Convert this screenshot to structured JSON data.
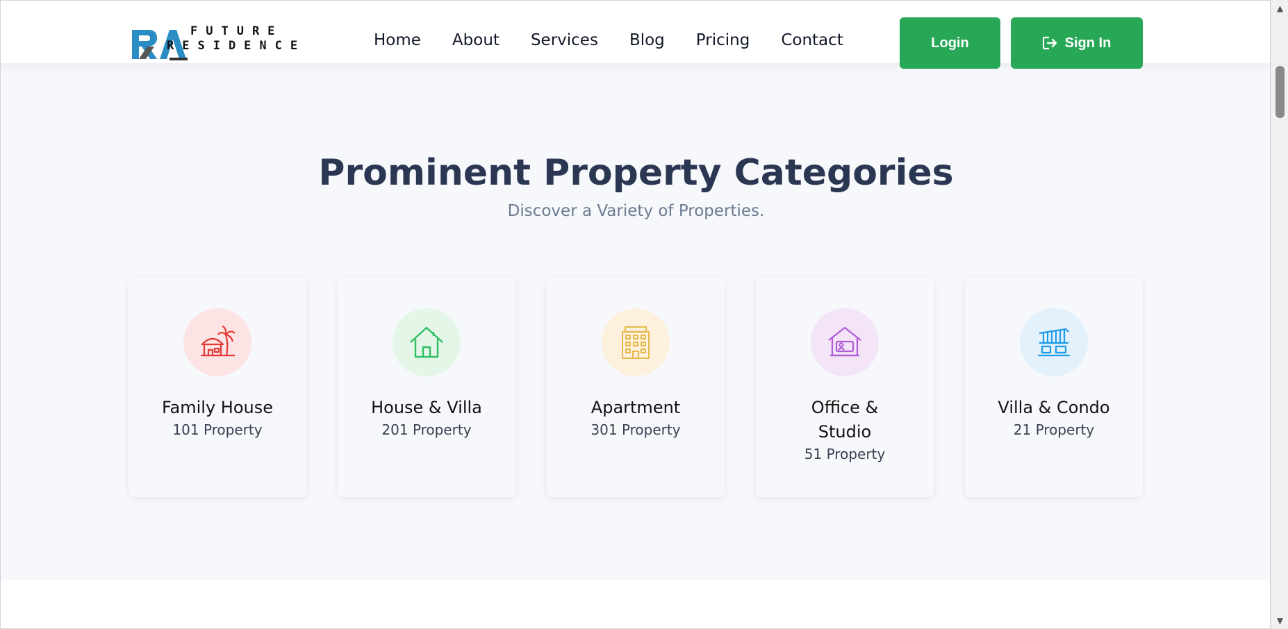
{
  "logo": {
    "mark": "RA",
    "line1": "FUTURE",
    "line2": "RESIDENCE"
  },
  "nav": [
    "Home",
    "About",
    "Services",
    "Blog",
    "Pricing",
    "Contact"
  ],
  "buttons": {
    "login": "Login",
    "signin": "Sign In",
    "signin_icon": "sign-in-icon"
  },
  "section": {
    "title": "Prominent Property Categories",
    "subtitle": "Discover a Variety of Properties."
  },
  "categories": [
    {
      "name": "Family House",
      "count": "101 Property",
      "icon": "beach-hut-icon",
      "color": "#e53935",
      "bg": "#fde4e4"
    },
    {
      "name": "House & Villa",
      "count": "201 Property",
      "icon": "house-icon",
      "color": "#2fbf63",
      "bg": "#e3f6e8"
    },
    {
      "name": "Apartment",
      "count": "301 Property",
      "icon": "apartment-building-icon",
      "color": "#e8b84a",
      "bg": "#fdf1dd"
    },
    {
      "name": "Office & Studio",
      "count": "51 Property",
      "icon": "office-studio-icon",
      "color": "#b05bd6",
      "bg": "#f3e4f8"
    },
    {
      "name": "Villa & Condo",
      "count": "21 Property",
      "icon": "villa-condo-icon",
      "color": "#1e9be8",
      "bg": "#e2f1fb"
    }
  ],
  "colors": {
    "accent": "#28a757",
    "title": "#2b3752",
    "subtitle": "#6b7a90"
  }
}
